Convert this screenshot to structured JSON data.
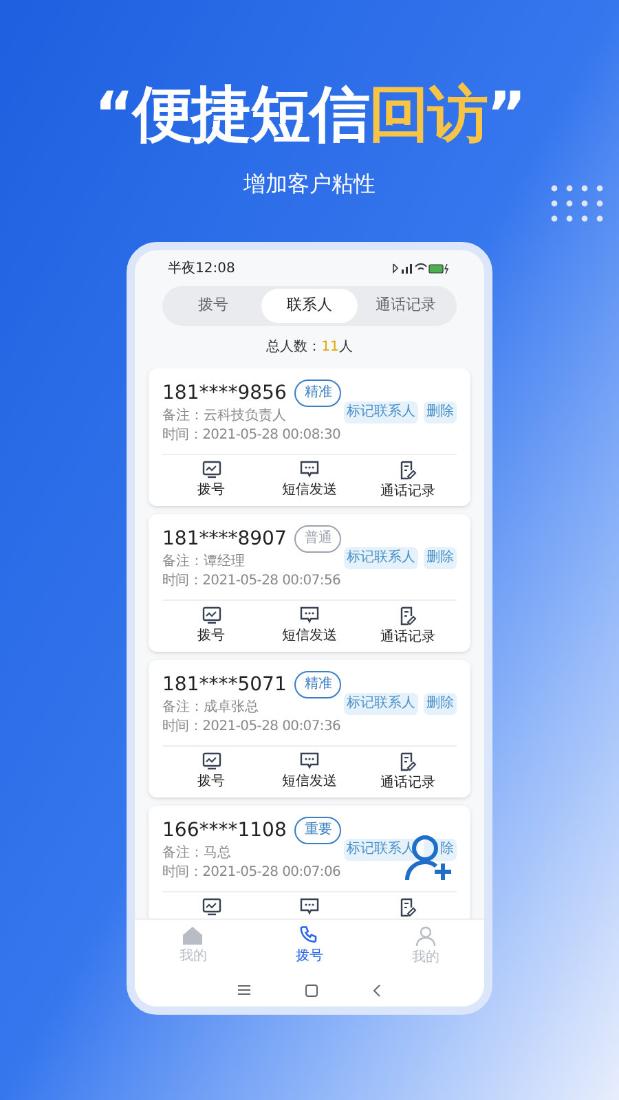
{
  "headline": [
    {
      "text": "“便捷短信",
      "highlight": false
    },
    {
      "text": "回访",
      "highlight": true
    },
    {
      "text": "”",
      "highlight": false
    }
  ],
  "subtitle": "增加客户粘性",
  "phone": {
    "status_time": "半夜12:08",
    "tabs": [
      {
        "label": "拨号",
        "selected": false
      },
      {
        "label": "联系人",
        "selected": true
      },
      {
        "label": "通话记录",
        "selected": false
      }
    ],
    "count_label": "总人数：",
    "count_value": "11",
    "count_unit": "人",
    "contacts": [
      {
        "number": "181****9856",
        "tag": {
          "label": "精准",
          "color": "#3b7fc4"
        },
        "remark": "备注：云科技负责人",
        "time": "时间：2021-05-28 00:08:30",
        "buttons": [
          "标记联系人",
          "删除"
        ],
        "actions": [
          {
            "kind": "dial",
            "label": "拨号"
          },
          {
            "kind": "sms",
            "label": "短信发送"
          },
          {
            "kind": "log",
            "label": "通话记录"
          }
        ]
      },
      {
        "number": "181****8907",
        "tag": {
          "label": "普通",
          "color": "#9ca3af"
        },
        "remark": "备注：谭经理",
        "time": "时间：2021-05-28 00:07:56",
        "buttons": [
          "标记联系人",
          "删除"
        ],
        "actions": [
          {
            "kind": "dial",
            "label": "拨号"
          },
          {
            "kind": "sms",
            "label": "短信发送"
          },
          {
            "kind": "log",
            "label": "通话记录"
          }
        ]
      },
      {
        "number": "181****5071",
        "tag": {
          "label": "精准",
          "color": "#3b7fc4"
        },
        "remark": "备注：成卓张总",
        "time": "时间：2021-05-28 00:07:36",
        "buttons": [
          "标记联系人",
          "删除"
        ],
        "actions": [
          {
            "kind": "dial",
            "label": "拨号"
          },
          {
            "kind": "sms",
            "label": "短信发送"
          },
          {
            "kind": "log",
            "label": "通话记录"
          }
        ]
      },
      {
        "number": "166****1108",
        "tag": {
          "label": "重要",
          "color": "#3b7fc4"
        },
        "remark": "备注：马总",
        "time": "时间：2021-05-28 00:07:06",
        "buttons": [
          "标记联系人",
          "除"
        ],
        "actions": [
          {
            "kind": "dial"
          },
          {
            "kind": "sms"
          },
          {
            "kind": "log"
          }
        ]
      }
    ],
    "nav": [
      {
        "kind": "home",
        "label": "我的",
        "selected": false
      },
      {
        "kind": "phone",
        "label": "拨号",
        "selected": true
      },
      {
        "kind": "user",
        "label": "我的",
        "selected": false
      }
    ]
  }
}
